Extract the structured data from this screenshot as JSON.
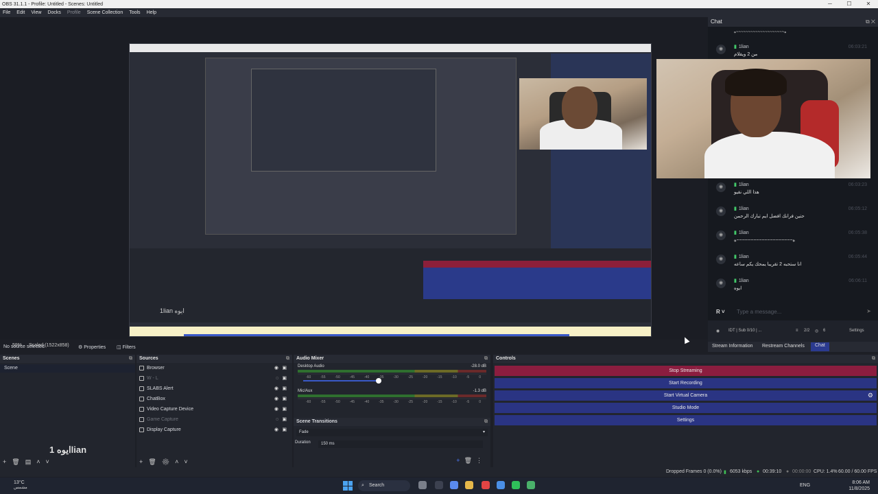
{
  "window": {
    "title": "OBS 31.1.1 - Profile: Untitled - Scenes: Untitled"
  },
  "menu": [
    "File",
    "Edit",
    "View",
    "Docks",
    "Profile",
    "Scene Collection",
    "Tools",
    "Help"
  ],
  "preview": {
    "inner_label": "1lian ايوه",
    "zoom": "59%",
    "scaled": "Scaled (1522x858)"
  },
  "properties_bar": {
    "no_source": "No source selected",
    "properties": "Properties",
    "filters": "Filters"
  },
  "chat": {
    "title": "Chat",
    "messages": [
      {
        "user": "1lian",
        "time": "06:03:21",
        "text": "من 2 ويقلام"
      },
      {
        "user": "1lian",
        "time": "06:03:23",
        "text": "هذا اللي نقيو"
      },
      {
        "user": "1lian",
        "time": "06:05:12",
        "text": "حتين فرانك افضل ايم تبارك الرحمن"
      },
      {
        "user": "1lian",
        "time": "06:05:38",
        "text": "ه~~~~~~~~~~~~~~~~~~~~ه"
      },
      {
        "user": "1lian",
        "time": "06:05:44",
        "text": "انا ستحبه 2 تقريبا يمحك يكم ساعه"
      },
      {
        "user": "1lian",
        "time": "06:06:11",
        "text": "ايوه"
      }
    ],
    "top_text": "ه~~~~~~~~~~~~~~~~~~~~ه",
    "input_placeholder": "Type a message...",
    "status": {
      "channel": "IDT | Sub 0/10 | ...",
      "count1": "2/2",
      "count2": "6",
      "settings": "Settings"
    },
    "tabs": {
      "stream_info": "Stream Information",
      "restream": "Restream Channels",
      "chat": "Chat"
    }
  },
  "scenes": {
    "title": "Scenes",
    "items": [
      "Scene"
    ]
  },
  "watermark": "ايوه 1lian",
  "sources": {
    "title": "Sources",
    "items": [
      {
        "name": "Browser",
        "visible": true
      },
      {
        "name": "W - L",
        "visible": false
      },
      {
        "name": "SLABS Alert",
        "visible": true
      },
      {
        "name": "ChatBox",
        "visible": true
      },
      {
        "name": "Video Capture Device",
        "visible": true
      },
      {
        "name": "Game Capture",
        "visible": false
      },
      {
        "name": "Display Capture",
        "visible": true
      }
    ]
  },
  "mixer": {
    "title": "Audio Mixer",
    "channels": [
      {
        "name": "Desktop Audio",
        "db": "-28.0 dB"
      },
      {
        "name": "Mic/Aux",
        "db": "-1.3 dB"
      }
    ],
    "scale": [
      "-60",
      "-55",
      "-50",
      "-45",
      "-40",
      "-35",
      "-30",
      "-25",
      "-20",
      "-15",
      "-10",
      "-5",
      "0"
    ]
  },
  "transitions": {
    "title": "Scene Transitions",
    "selected": "Fade",
    "duration_label": "Duration",
    "duration_value": "150 ms"
  },
  "controls": {
    "title": "Controls",
    "stop_streaming": "Stop Streaming",
    "start_recording": "Start Recording",
    "start_virtual_camera": "Start Virtual Camera",
    "studio_mode": "Studio Mode",
    "settings": "Settings"
  },
  "status_bar": {
    "dropped": "Dropped Frames 0 (0.0%)",
    "kbps": "6053 kbps",
    "stream_time": "00:39:10",
    "rec_time": "00:00:00",
    "cpu": "CPU: 1.4%",
    "fps": "60.00 / 60.00 FPS"
  },
  "taskbar": {
    "weather": "13°C",
    "weather_desc": "مشمس",
    "search": "Search",
    "lang": "ENG",
    "time": "8:06 AM",
    "date": "11/8/2025"
  },
  "colors": {
    "stop_streaming": "#8b1d3f",
    "control_button": "#2a3483",
    "chat_username": "#42c96a"
  }
}
